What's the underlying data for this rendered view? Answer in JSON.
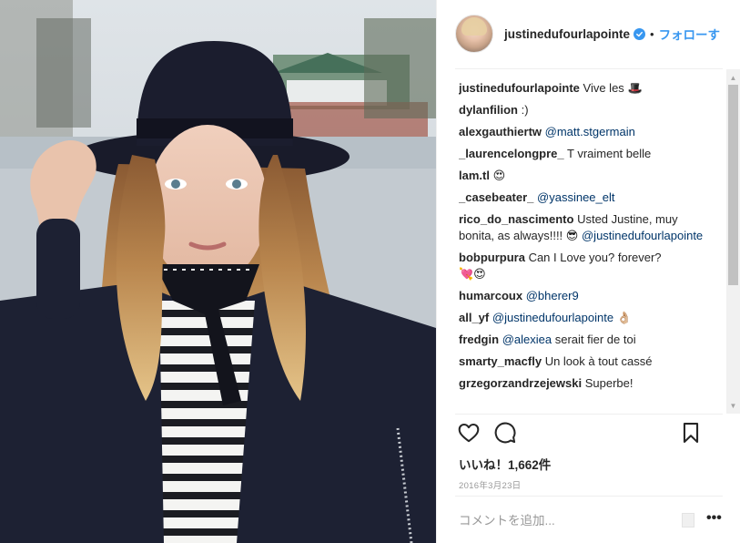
{
  "post": {
    "author": "justinedufourlapointe",
    "separator": "•",
    "follow_label": "フォローす",
    "likes_label": "いいね！1,662件",
    "date_label": "2016年3月23日",
    "comment_placeholder": "コメントを追加...",
    "more_label": "•••"
  },
  "comments": [
    {
      "user": "justinedufourlapointe",
      "text": "Vive les",
      "emoji": "🎩"
    },
    {
      "user": "dylanfilion",
      "text": ":)"
    },
    {
      "user": "alexgauthiertw",
      "mention": "@matt.stgermain"
    },
    {
      "user": "_laurencelongpre_",
      "text": "T vraiment belle"
    },
    {
      "user": "lam.tl",
      "emoji": "😍"
    },
    {
      "user": "_casebeater_",
      "mention": "@yassinee_elt"
    },
    {
      "user": "rico_do_nascimento",
      "text": "Usted Justine, muy bonita, as always!!!!",
      "emoji": "😎",
      "mention2": "@justinedufourlapointe"
    },
    {
      "user": "bobpurpura",
      "text": "Can I Love you? forever?",
      "emoji": "💘😍"
    },
    {
      "user": "humarcoux",
      "mention": "@bherer9"
    },
    {
      "user": "all_yf",
      "mention": "@justinedufourlapointe",
      "emoji": "👌🏼"
    },
    {
      "user": "fredgin",
      "mention": "@alexiea",
      "text": "serait fier de toi"
    },
    {
      "user": "smarty_macfly",
      "text": "Un look à tout cassé"
    },
    {
      "user": "grzegorzandrzejewski",
      "text": "Superbe!"
    }
  ],
  "scrollbar": {
    "up": "▲",
    "down": "▼"
  },
  "colors": {
    "link": "#003569",
    "accent": "#3897f0",
    "text": "#262626",
    "muted": "#999999"
  },
  "icons": [
    "heart-icon",
    "comment-icon",
    "bookmark-icon",
    "verified-badge-icon"
  ]
}
